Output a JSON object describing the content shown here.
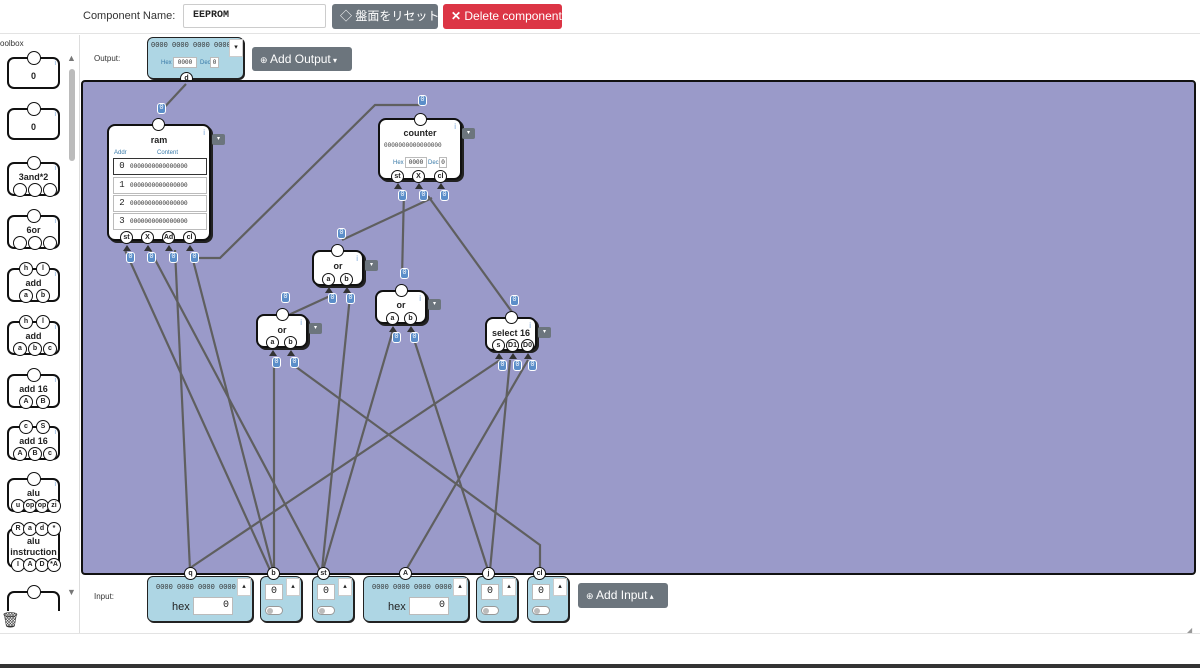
{
  "header": {
    "component_name_label": "Component Name:",
    "component_name_value": "EEPROM",
    "reset_label": "盤面をリセット",
    "delete_label": "Delete component"
  },
  "toolbox": {
    "title": "oolbox",
    "items": [
      {
        "label": "0"
      },
      {
        "label": "0"
      },
      {
        "label": "3and*2"
      },
      {
        "label": "6or"
      },
      {
        "label": "add",
        "pins_top": [
          "h",
          "l"
        ],
        "pins_bottom": [
          "a",
          "b"
        ]
      },
      {
        "label": "add",
        "pins_top": [
          "h",
          "l"
        ],
        "pins_bottom": [
          "a",
          "b",
          "c"
        ]
      },
      {
        "label": "add 16",
        "pins_bottom": [
          "A",
          "B"
        ]
      },
      {
        "label": "add 16",
        "pins_top": [
          "c",
          "S"
        ],
        "pins_bottom": [
          "A",
          "B",
          "c"
        ]
      },
      {
        "label": "alu",
        "pins_bottom": [
          "u",
          "op",
          "op",
          "zi"
        ]
      },
      {
        "label": "alu instruction",
        "pins_top": [
          "R",
          "a",
          "d",
          "*"
        ],
        "pins_bottom": [
          "I",
          "A",
          "D",
          "*A"
        ]
      }
    ]
  },
  "output": {
    "label": "Output:",
    "bits": "0000 0000 0000 0000",
    "hex_label": "Hex",
    "hex_value": "0000",
    "dec_label": "Dec",
    "dec_value": "0",
    "pin": "d",
    "add_label": "Add Output"
  },
  "board": {
    "components": {
      "ram": {
        "name": "ram",
        "addr_label": "Addr",
        "content_label": "Content",
        "rows": [
          {
            "addr": "0",
            "content": "0000000000000000"
          },
          {
            "addr": "1",
            "content": "0000000000000000"
          },
          {
            "addr": "2",
            "content": "0000000000000000"
          },
          {
            "addr": "3",
            "content": "0000000000000000"
          }
        ],
        "pins": [
          "st",
          "X",
          "Ad",
          "cl"
        ]
      },
      "counter": {
        "name": "counter",
        "bits": "0000000000000000",
        "hex_label": "Hex",
        "hex_value": "0000",
        "dec_label": "Dec",
        "dec_value": "0",
        "pins": [
          "st",
          "X",
          "cl"
        ]
      },
      "or1": {
        "name": "or",
        "pins": [
          "a",
          "b"
        ]
      },
      "or2": {
        "name": "or",
        "pins": [
          "a",
          "b"
        ]
      },
      "or3": {
        "name": "or",
        "pins": [
          "a",
          "b"
        ]
      },
      "select": {
        "name": "select 16",
        "pins": [
          "s",
          "D1",
          "D0"
        ]
      }
    },
    "wire_value": "0"
  },
  "input": {
    "label": "Input:",
    "add_label": "Add Input",
    "panels": [
      {
        "pin": "q",
        "bits": "0000 0000 0000 0000",
        "hex_label": "hex",
        "value": "0"
      },
      {
        "pin": "b",
        "value": "0"
      },
      {
        "pin": "st",
        "value": "0"
      },
      {
        "pin": "A",
        "bits": "0000 0000 0000 0000",
        "hex_label": "hex",
        "value": "0"
      },
      {
        "pin": "j",
        "value": "0"
      },
      {
        "pin": "cl",
        "value": "0"
      }
    ]
  },
  "colors": {
    "board": "#9a9ac9",
    "panel": "#aed6e4",
    "danger": "#dc3545",
    "secondary": "#6c757d",
    "value_chip": "#5b8ec9"
  }
}
